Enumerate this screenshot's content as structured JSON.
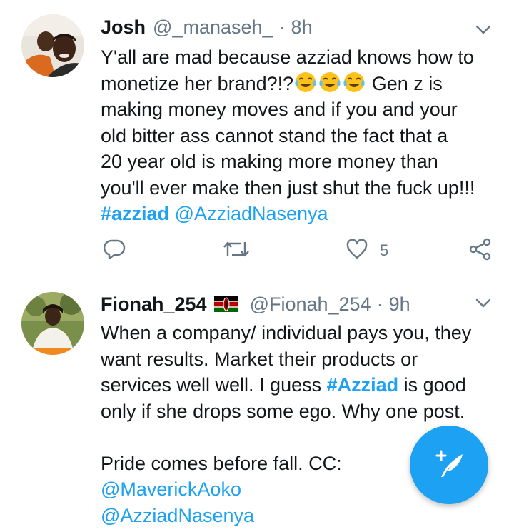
{
  "tweets": [
    {
      "name": "Josh",
      "handle": "@_manaseh_",
      "dot": "·",
      "time": "8h",
      "text_lines": [
        [
          "Y'all are mad because azziad knows how to"
        ],
        [
          "monetize her brand?!?",
          "Gen z is"
        ],
        [
          "making money moves and if you and your"
        ],
        [
          "old bitter ass cannot stand the fact that a"
        ],
        [
          "20 year old is making more money than"
        ],
        [
          "you'll ever make then just shut the fuck up!!!"
        ]
      ],
      "hashtag": "#azziad",
      "mention": "@AzziadNasenya",
      "emoji": "face-with-tears-of-joy",
      "emoji_count": 3,
      "like_count": "5"
    },
    {
      "name": "Fionah_254",
      "flag": "kenya-flag",
      "handle": "@Fionah_254",
      "dot": "·",
      "time": "9h",
      "line1": "When a company/ individual pays you,  they",
      "line2": "want results.  Market their products or",
      "line3_pre": "services well well.  I guess ",
      "hashtag": "#Azziad",
      "line3_post": " is good",
      "line4": "only if she drops some ego.  Why one post.",
      "line6": "Pride comes  before fall.  CC:",
      "mention1": "@MaverickAoko",
      "mention2": "@AzziadNasenya"
    }
  ],
  "colors": {
    "accent": "#1da1f2",
    "text": "#14171a",
    "secondary": "#657786",
    "divider": "#e1e8ed"
  },
  "icons": {
    "reply": "reply-icon",
    "retweet": "retweet-icon",
    "like": "heart-icon",
    "share": "share-icon",
    "menu": "chevron-down-icon",
    "compose": "compose-tweet-icon"
  }
}
